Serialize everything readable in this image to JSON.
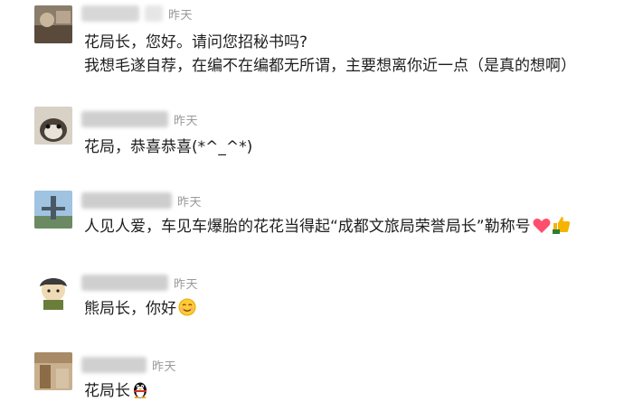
{
  "comments": [
    {
      "time": "昨天",
      "lines": [
        "花局长，您好。请问您招秘书吗?",
        "我想毛遂自荐，在编不在编都无所谓，主要想离你近一点（是真的想啊）"
      ]
    },
    {
      "time": "昨天",
      "lines": [
        "花局，恭喜恭喜(*^_^*)"
      ]
    },
    {
      "time": "昨天",
      "lines": [
        "人见人爱，车见车爆胎的花花当得起“成都文旅局荣誉局长”勒称号"
      ],
      "emojis": [
        "heart-icon",
        "thumbs-up-icon"
      ],
      "accent_heart": "#ff4f6d",
      "accent_thumb": "#f4b400"
    },
    {
      "time": "昨天",
      "lines": [
        "熊局长，你好"
      ],
      "emojis": [
        "smile-icon"
      ]
    },
    {
      "time": "昨天",
      "lines": [
        "花局长"
      ],
      "emojis": [
        "penguin-icon"
      ]
    }
  ]
}
